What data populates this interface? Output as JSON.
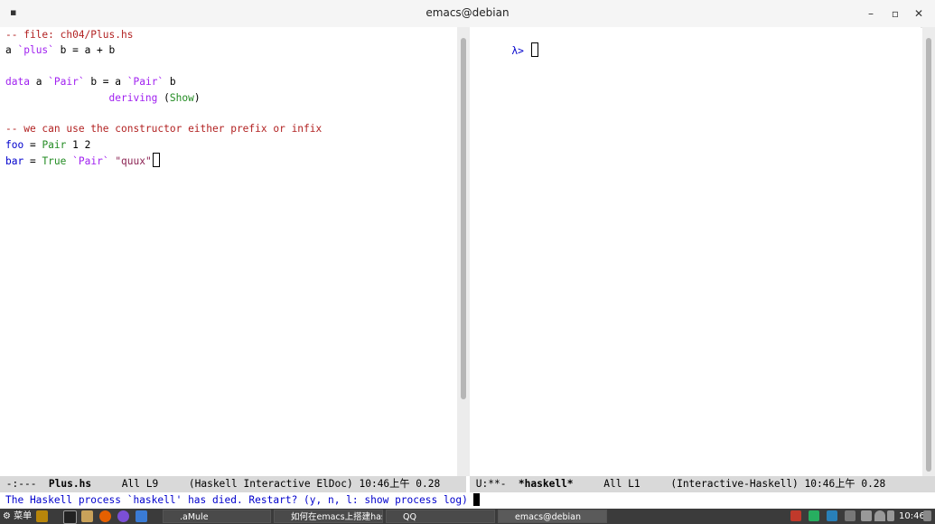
{
  "window": {
    "title": "emacs@debian",
    "minimize": "–",
    "maximize": "▫",
    "close": "✕"
  },
  "left_buffer": {
    "lines": [
      [
        {
          "t": "-- file: ch04/Plus.hs",
          "c": "comment"
        }
      ],
      [
        {
          "t": "a ",
          "c": "text"
        },
        {
          "t": "`plus`",
          "c": "kw"
        },
        {
          "t": " b = a + b",
          "c": "text"
        }
      ],
      [],
      [
        {
          "t": "data",
          "c": "kw"
        },
        {
          "t": " a ",
          "c": "text"
        },
        {
          "t": "`Pair`",
          "c": "kw"
        },
        {
          "t": " b = a ",
          "c": "text"
        },
        {
          "t": "`Pair`",
          "c": "kw"
        },
        {
          "t": " b",
          "c": "text"
        }
      ],
      [
        {
          "t": "                 ",
          "c": "text"
        },
        {
          "t": "deriving",
          "c": "kw"
        },
        {
          "t": " (",
          "c": "text"
        },
        {
          "t": "Show",
          "c": "ctor"
        },
        {
          "t": ")",
          "c": "text"
        }
      ],
      [],
      [
        {
          "t": "-- we can use the constructor either prefix or infix",
          "c": "comment"
        }
      ],
      [
        {
          "t": "foo",
          "c": "var"
        },
        {
          "t": " = ",
          "c": "text"
        },
        {
          "t": "Pair",
          "c": "ctor"
        },
        {
          "t": " 1 2",
          "c": "text"
        }
      ],
      [
        {
          "t": "bar",
          "c": "var"
        },
        {
          "t": " = ",
          "c": "text"
        },
        {
          "t": "True",
          "c": "ctor"
        },
        {
          "t": " ",
          "c": "text"
        },
        {
          "t": "`Pair`",
          "c": "kw"
        },
        {
          "t": " ",
          "c": "text"
        },
        {
          "t": "\"quux\"",
          "c": "str"
        },
        {
          "t": "CURSOR",
          "c": "cursor"
        }
      ]
    ]
  },
  "right_buffer": {
    "prompt": "λ>"
  },
  "modeline_left": {
    "state": "-:---",
    "buffer": "Plus.hs",
    "position": "All L9",
    "modes": "(Haskell Interactive ElDoc)",
    "time": "10:46上午 0.28"
  },
  "modeline_right": {
    "state": "U:**-",
    "buffer": "*haskell*",
    "position": "All L1",
    "modes": "(Interactive-Haskell)",
    "time": "10:46上午 0.28"
  },
  "minibuffer": {
    "message": "The Haskell process `haskell' has died. Restart? (y, n, l: show process log)"
  },
  "taskbar": {
    "menu_label": "菜单",
    "tasks": [
      {
        "label": ".aMule",
        "active": false
      },
      {
        "label": "如何在emacs上搭建has…",
        "active": false
      },
      {
        "label": "QQ",
        "active": false
      },
      {
        "label": "emacs@debian",
        "active": true
      }
    ],
    "clock": "10:46"
  },
  "colors": {
    "comment": "#b22222",
    "keyword": "#a020f0",
    "variable": "#0000cd",
    "constructor": "#228b22",
    "string": "#8b2252",
    "minibuffer_text": "#0000cd"
  }
}
